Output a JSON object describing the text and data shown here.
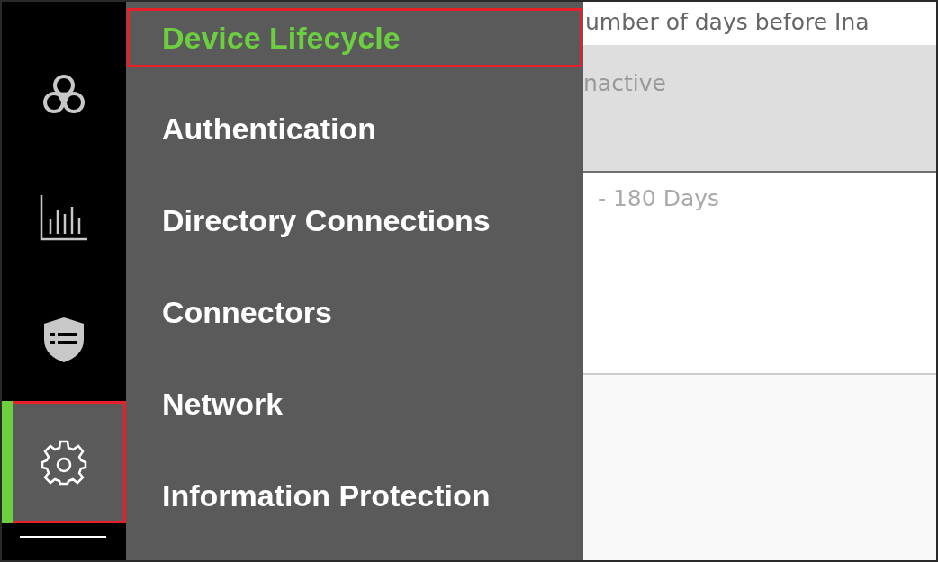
{
  "rail": {
    "items": [
      {
        "selected": false,
        "highlighted": false
      },
      {
        "selected": false,
        "highlighted": false
      },
      {
        "selected": false,
        "highlighted": false
      },
      {
        "selected": true,
        "highlighted": true
      }
    ]
  },
  "menu": {
    "items": [
      {
        "label": "Device Lifecycle",
        "selected": true,
        "highlighted": true
      },
      {
        "label": "Authentication",
        "selected": false,
        "highlighted": false
      },
      {
        "label": "Directory Connections",
        "selected": false,
        "highlighted": false
      },
      {
        "label": "Connectors",
        "selected": false,
        "highlighted": false
      },
      {
        "label": "Network",
        "selected": false,
        "highlighted": false
      },
      {
        "label": "Information Protection",
        "selected": false,
        "highlighted": false
      }
    ]
  },
  "content": {
    "description": "umber of days before Ina",
    "column_header": "nactive",
    "cell": "- 180 Days"
  }
}
